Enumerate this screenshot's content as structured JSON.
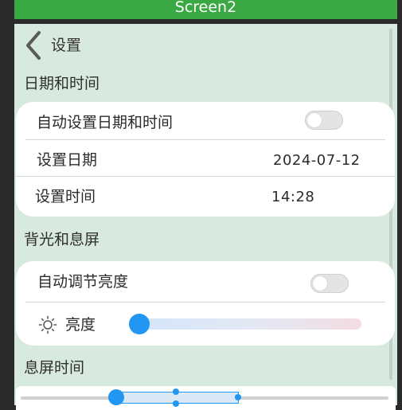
{
  "window": {
    "title": "Screen2"
  },
  "header": {
    "back_label": "设置"
  },
  "sections": {
    "datetime": {
      "title": "日期和时间",
      "auto_label": "自动设置日期和时间",
      "auto_enabled": false,
      "date_label": "设置日期",
      "date_value": "2024-07-12",
      "time_label": "设置时间",
      "time_value": "14:28"
    },
    "backlight": {
      "title": "背光和息屏",
      "auto_brightness_label": "自动调节亮度",
      "auto_brightness_enabled": false,
      "brightness_label": "亮度",
      "brightness_level": 0.0
    },
    "screen_off": {
      "title": "息屏时间"
    }
  },
  "colors": {
    "title_bar": "#3aa843",
    "background": "#d8eadf",
    "accent": "#2196f3",
    "card": "#ffffff"
  },
  "icons": {
    "back": "chevron-left-icon",
    "brightness": "sun-icon"
  }
}
